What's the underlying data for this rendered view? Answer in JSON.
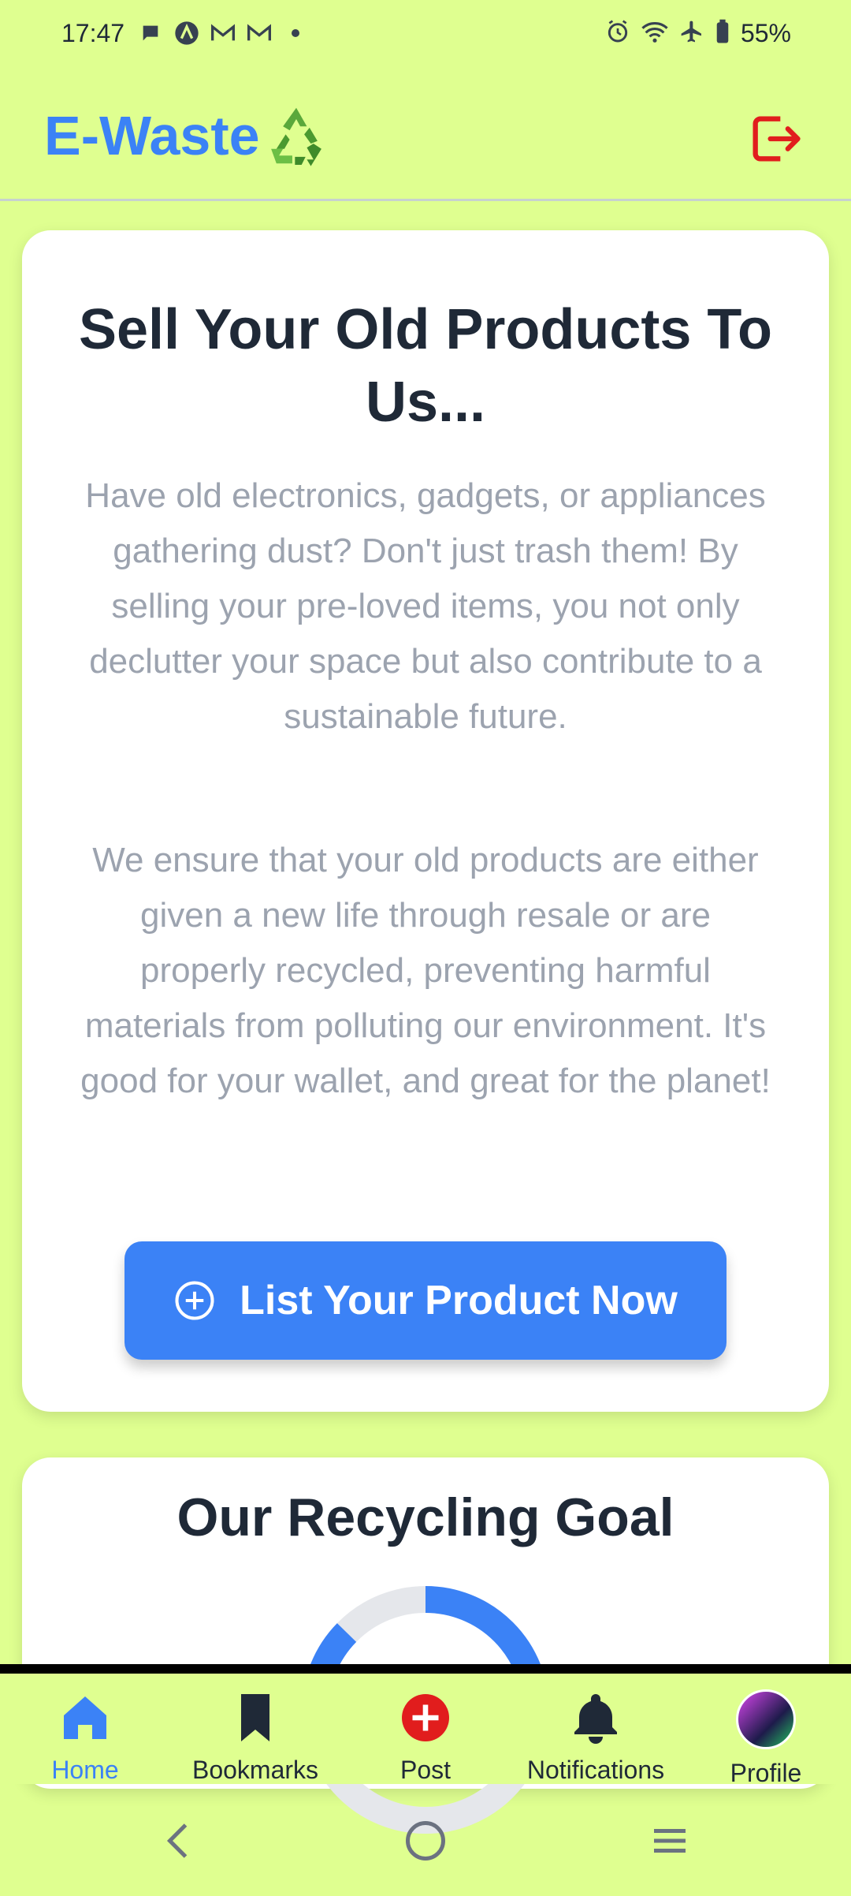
{
  "status_bar": {
    "time": "17:47",
    "battery": "55%"
  },
  "header": {
    "brand": "E-Waste",
    "brand_icon": "recycle-icon",
    "logout_icon": "logout-icon"
  },
  "hero": {
    "title": "Sell Your Old Products To Us...",
    "paragraph1": "Have old electronics, gadgets, or appliances gathering dust? Don't just trash them! By selling your pre-loved items, you not only declutter your space but also contribute to a sustainable future.",
    "paragraph2": "We ensure that your old products are either given a new life through resale or are properly recycled, preventing harmful materials from polluting our environment. It's good for your wallet, and great for the planet!",
    "cta_label": "List Your Product Now"
  },
  "goal": {
    "title": "Our Recycling Goal"
  },
  "bottom_nav": {
    "items": [
      {
        "label": "Home",
        "icon": "home-icon",
        "active": true
      },
      {
        "label": "Bookmarks",
        "icon": "bookmark-icon"
      },
      {
        "label": "Post",
        "icon": "plus-circle-icon"
      },
      {
        "label": "Notifications",
        "icon": "bell-icon"
      },
      {
        "label": "Profile",
        "icon": "avatar"
      }
    ]
  },
  "colors": {
    "background": "#dfff90",
    "accent": "#3b82f6",
    "logout": "#e11d1d"
  }
}
